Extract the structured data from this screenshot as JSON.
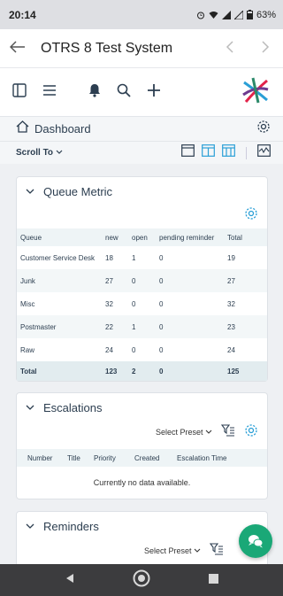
{
  "status_bar": {
    "time": "20:14",
    "battery": "63%"
  },
  "app_bar": {
    "title": "OTRS 8 Test System"
  },
  "dashboard": {
    "crumb": "Dashboard",
    "scroll_to": "Scroll To"
  },
  "queue_metric": {
    "title": "Queue Metric",
    "columns": [
      "Queue",
      "new",
      "open",
      "pending reminder",
      "Total"
    ],
    "rows": [
      [
        "Customer Service Desk",
        "18",
        "1",
        "0",
        "19"
      ],
      [
        "Junk",
        "27",
        "0",
        "0",
        "27"
      ],
      [
        "Misc",
        "32",
        "0",
        "0",
        "32"
      ],
      [
        "Postmaster",
        "22",
        "1",
        "0",
        "23"
      ],
      [
        "Raw",
        "24",
        "0",
        "0",
        "24"
      ]
    ],
    "total": [
      "Total",
      "123",
      "2",
      "0",
      "125"
    ]
  },
  "escalations": {
    "title": "Escalations",
    "preset": "Select Preset",
    "columns": [
      "Number",
      "Title",
      "Priority",
      "Created",
      "Escalation Time"
    ],
    "empty": "Currently no data available."
  },
  "reminders": {
    "title": "Reminders",
    "preset": "Select Preset"
  },
  "colors": {
    "accent": "#2a9fd6",
    "fab": "#1aa877"
  }
}
